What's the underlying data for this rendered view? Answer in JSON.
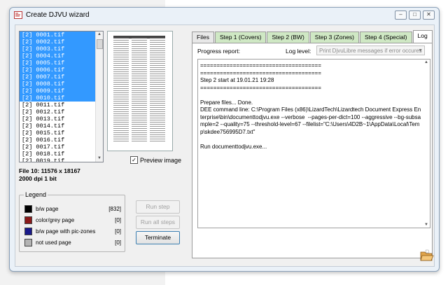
{
  "window": {
    "title": "Create DJVU wizard",
    "buttons": [
      "minimize",
      "restore",
      "close"
    ]
  },
  "files": [
    {
      "label": "[2] 0001.tif",
      "selected": true
    },
    {
      "label": "[2] 0002.tif",
      "selected": true
    },
    {
      "label": "[2] 0003.tif",
      "selected": true
    },
    {
      "label": "[2] 0004.tif",
      "selected": true
    },
    {
      "label": "[2] 0005.tif",
      "selected": true
    },
    {
      "label": "[2] 0006.tif",
      "selected": true
    },
    {
      "label": "[2] 0007.tif",
      "selected": true
    },
    {
      "label": "[2] 0008.tif",
      "selected": true
    },
    {
      "label": "[2] 0009.tif",
      "selected": true
    },
    {
      "label": "[2] 0010.tif",
      "selected": true
    },
    {
      "label": "[2] 0011.tif",
      "selected": false
    },
    {
      "label": "[2] 0012.tif",
      "selected": false
    },
    {
      "label": "[2] 0013.tif",
      "selected": false
    },
    {
      "label": "[2] 0014.tif",
      "selected": false
    },
    {
      "label": "[2] 0015.tif",
      "selected": false
    },
    {
      "label": "[2] 0016.tif",
      "selected": false
    },
    {
      "label": "[2] 0017.tif",
      "selected": false
    },
    {
      "label": "[2] 0018.tif",
      "selected": false
    },
    {
      "label": "[2] 0019.tif",
      "selected": false
    }
  ],
  "preview": {
    "checkbox_label": "Preview image",
    "checked": true
  },
  "fileinfo": {
    "line1": "File 10: 11576 x 18167",
    "line2": "2000 dpi  1 bit"
  },
  "legend": {
    "title": "Legend",
    "items": [
      {
        "label": "b/w page",
        "count": "[832]",
        "color": "#000000"
      },
      {
        "label": "color/grey page",
        "count": "[0]",
        "color": "#8b1a1a"
      },
      {
        "label": "b/w page with pic-zones",
        "count": "[0]",
        "color": "#1a1a8b"
      },
      {
        "label": "not used page",
        "count": "[0]",
        "color": "#b4b4b4"
      }
    ]
  },
  "buttons": {
    "run_step": "Run step",
    "run_all": "Run all steps",
    "terminate": "Terminate"
  },
  "tabs": [
    {
      "label": "Files",
      "style": "plain"
    },
    {
      "label": "Step 1 (Covers)",
      "style": "green"
    },
    {
      "label": "Step 2 (BW)",
      "style": "green"
    },
    {
      "label": "Step 3 (Zones)",
      "style": "green"
    },
    {
      "label": "Step 4 (Special)",
      "style": "green"
    },
    {
      "label": "Log",
      "style": "active"
    }
  ],
  "log": {
    "progress_label": "Progress report:",
    "level_label": "Log level:",
    "level_value": "Print DjvuLibre messages if error occures",
    "text": "=====================================\n=====================================\nStep 2 start at 19.01.21 19:28\n=====================================\n\nPrepare files... Done.\nDEE command line: C:\\Program Files (x86)\\LizardTech\\Lizardtech Document Express Enterprise\\bin\\documenttodjvu.exe --verbose  --pages-per-dict=100 --aggressive --bg-subsample=2 --quality=75 --threshold-level=67 --filelist=\"C:\\Users\\4D2B~1\\AppData\\Local\\Temp\\skdee756995D7.txt\"\n\nRun documenttodjvu.exe..."
  }
}
